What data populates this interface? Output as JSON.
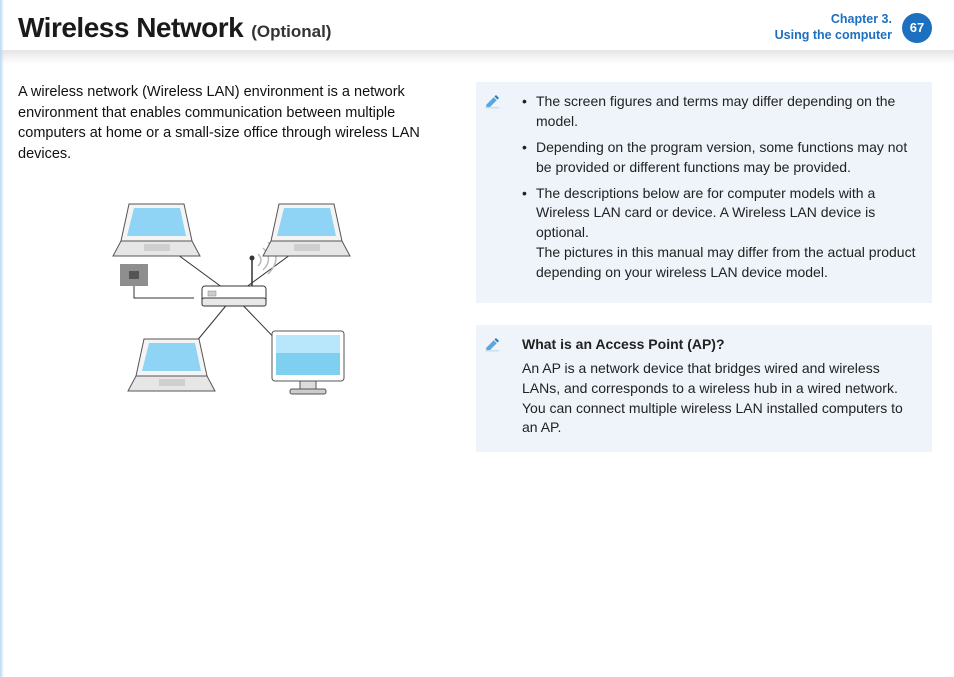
{
  "header": {
    "title": "Wireless Network",
    "subtitle": "(Optional)",
    "chapter_line1": "Chapter 3.",
    "chapter_line2": "Using the computer",
    "page_number": "67"
  },
  "intro": "A wireless network (Wireless LAN) environment is a network environment that enables communication between multiple computers at home or a small-size office through wireless LAN devices.",
  "notes": {
    "items": [
      {
        "text": "The screen figures and terms may differ depending on the model."
      },
      {
        "text": "Depending on the program version, some functions may not be provided or different functions may be provided."
      },
      {
        "text": "The descriptions below are for computer models with a Wireless LAN card or device. A Wireless LAN device is optional.",
        "sub": "The pictures in this manual may differ from the actual product depending on your wireless LAN device model."
      }
    ]
  },
  "ap_box": {
    "title": "What is an Access Point (AP)?",
    "body": "An AP is a network device that bridges wired and wireless LANs, and corresponds to a wireless hub in a wired network. You can connect multiple wireless LAN installed computers to an AP."
  },
  "icons": {
    "note": "pencil-note-icon"
  },
  "diagram_label": "wireless-network-diagram"
}
